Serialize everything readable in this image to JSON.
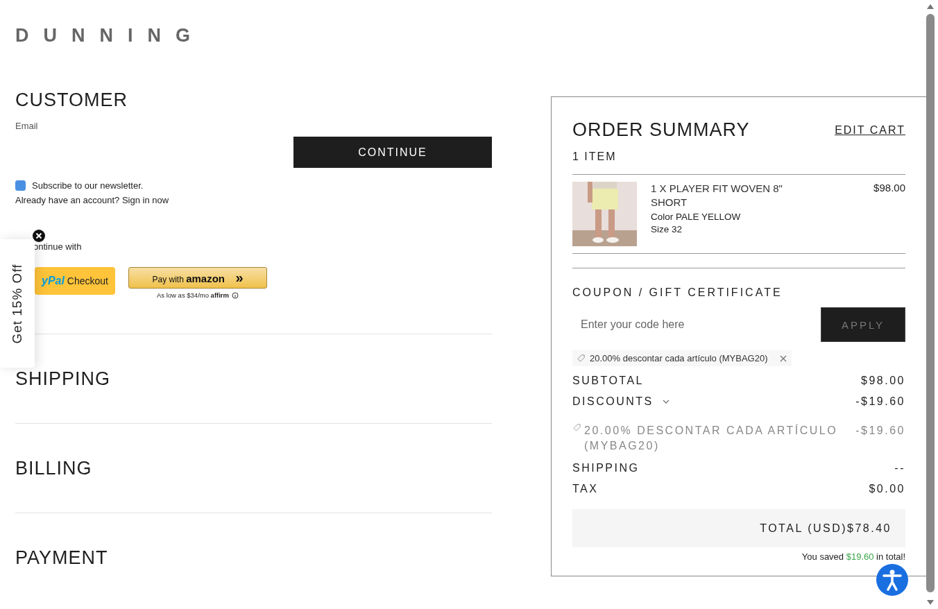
{
  "logo": "DUNNING",
  "customer": {
    "title": "CUSTOMER",
    "email_label": "Email",
    "continue_button": "CONTINUE",
    "newsletter": {
      "label": "Subscribe to our newsletter.",
      "checked": true
    },
    "sign_in_text": "Already have an account? Sign in now",
    "continue_with": "ontinue with",
    "paypal_button": {
      "brand": "yPal",
      "label": "Checkout"
    },
    "amazon_button": {
      "prefix": "Pay with",
      "brand": "amazon",
      "arrow": "»"
    },
    "affirm_note": {
      "text": "As low as $34/mo",
      "brand": "affirm"
    }
  },
  "sections": [
    "SHIPPING",
    "BILLING",
    "PAYMENT"
  ],
  "promo_tab": {
    "label": "Get 15% Off"
  },
  "order_summary": {
    "title": "ORDER SUMMARY",
    "edit_cart": "EDIT CART",
    "item_count": "1 ITEM",
    "items": [
      {
        "kind": "picture",
        "name": "1 X PLAYER FIT WOVEN 8\" SHORT",
        "color_label": "Color PALE YELLOW",
        "size": "Size 32",
        "price": "$98.00"
      }
    ],
    "coupon": {
      "title": "COUPON / GIFT CERTIFICATE",
      "placeholder": "Enter your code here",
      "apply_button": "APPLY",
      "applied": "20.00% descontar cada artículo (MYBAG20)"
    },
    "totals": [
      {
        "kind": "plain",
        "label": "SUBTOTAL",
        "value": "$98.00"
      },
      {
        "kind": "expandable",
        "label": "DISCOUNTS",
        "value": "-$19.60"
      },
      {
        "kind": "discount",
        "label": "20.00% DESCONTAR CADA ARTÍCULO (MYBAG20)",
        "value": "-$19.60"
      },
      {
        "kind": "plain",
        "label": "SHIPPING",
        "value": "--"
      },
      {
        "kind": "plain",
        "label": "TAX",
        "value": "$0.00"
      }
    ],
    "total": {
      "label": "TOTAL (USD)",
      "value": "$78.40"
    },
    "savings": {
      "prefix": "You saved",
      "amount": "$19.60",
      "suffix": "in total!"
    }
  }
}
